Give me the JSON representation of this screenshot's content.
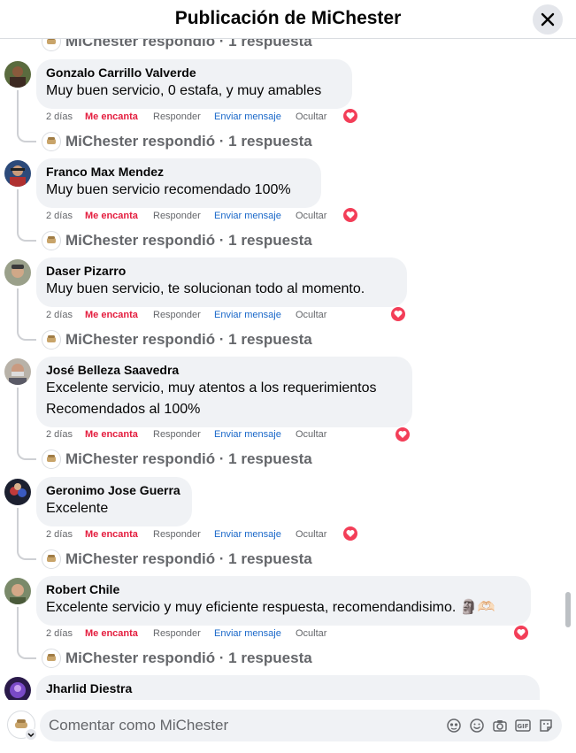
{
  "header": {
    "title": "Publicación de MiChester"
  },
  "common": {
    "time": "2 días",
    "love": "Me encanta",
    "reply": "Responder",
    "message": "Enviar mensaje",
    "hide": "Ocultar",
    "reply_summary": "MiChester respondió · 1 respuesta",
    "brand_mark": "mi chester"
  },
  "comments": [
    {
      "author": "Gonzalo Carrillo Valverde",
      "lines": [
        "Muy buen servicio, 0 estafa, y muy amables"
      ]
    },
    {
      "author": "Franco Max Mendez",
      "lines": [
        "Muy buen servicio recomendado 100%"
      ]
    },
    {
      "author": "Daser Pizarro",
      "lines": [
        "Muy buen servicio, te solucionan todo al momento."
      ]
    },
    {
      "author": "José Belleza Saavedra",
      "lines": [
        "Excelente servicio, muy atentos a los requerimientos",
        "Recomendados al 100%"
      ]
    },
    {
      "author": "Geronimo Jose Guerra",
      "lines": [
        "Excelente"
      ]
    },
    {
      "author": "Robert Chile",
      "lines": [
        "Excelente servicio y muy eficiente respuesta, recomendandisimo. 🗿🫶🏻"
      ]
    },
    {
      "author": "Jharlid Diestra",
      "lines": [
        ""
      ]
    }
  ],
  "composer": {
    "placeholder": "Comentar como MiChester"
  },
  "colors": {
    "love": "#e41e3f",
    "message_link": "#1a68c9",
    "bubble": "#f0f2f5",
    "heart": "#f33e58"
  },
  "icons": {
    "close": "close-icon",
    "heart": "heart-reaction-icon",
    "avatar_sticker": "avatar-sticker-icon",
    "emoji": "emoji-icon",
    "camera": "camera-icon",
    "gif": "gif-icon",
    "sticker": "sticker-icon"
  }
}
